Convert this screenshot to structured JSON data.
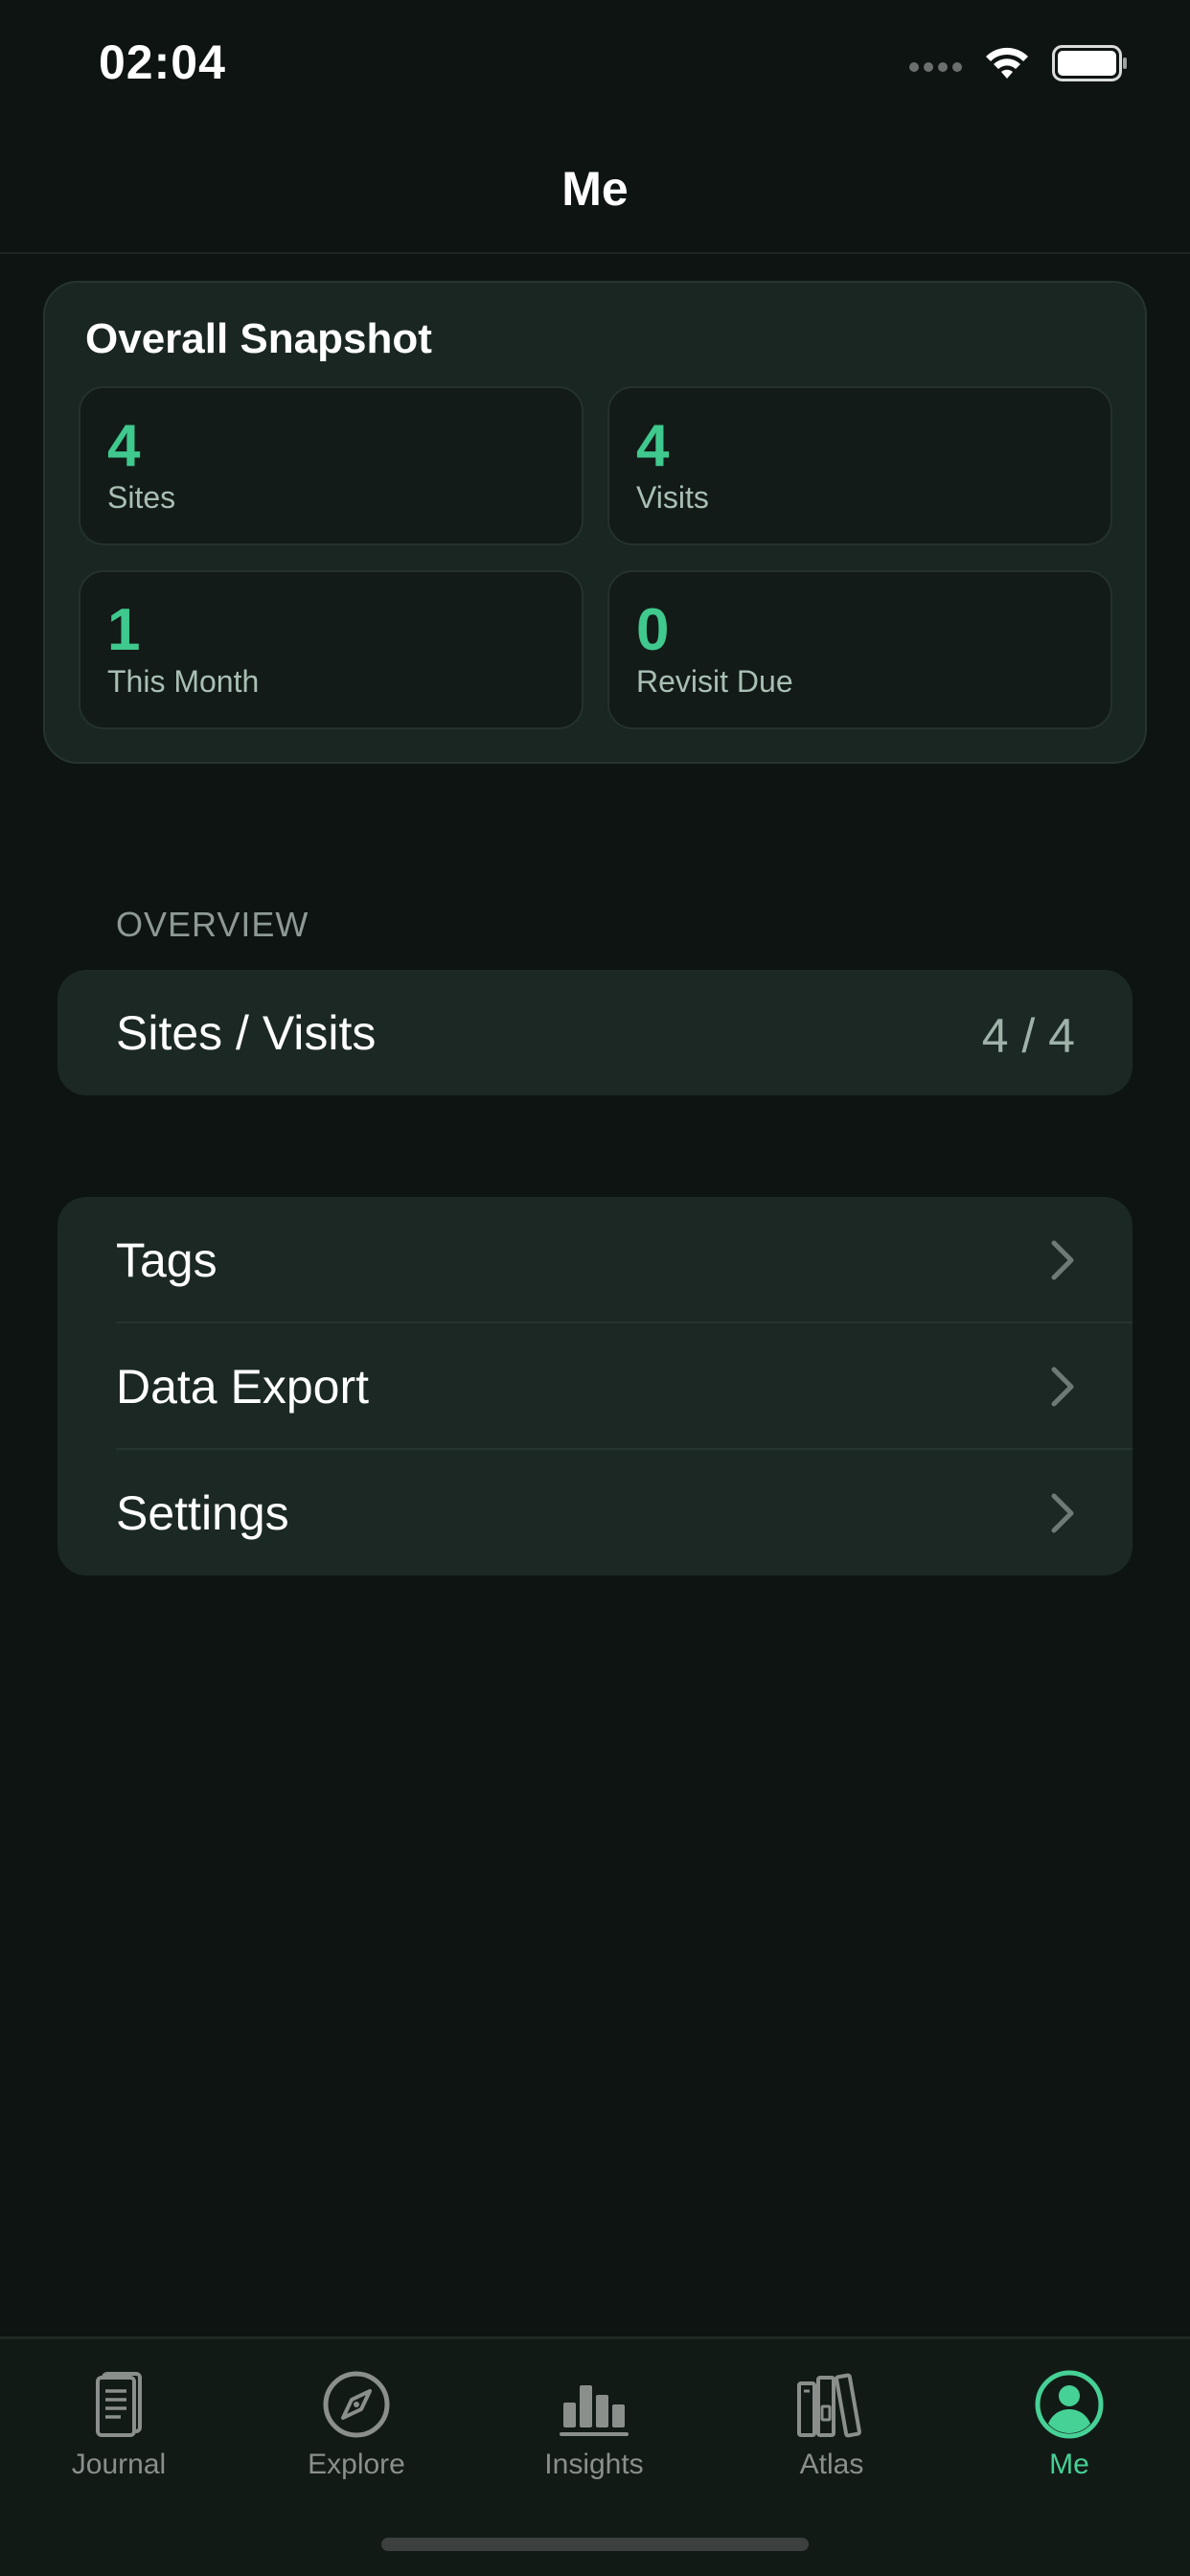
{
  "status_bar": {
    "time": "02:04"
  },
  "nav": {
    "title": "Me"
  },
  "snapshot": {
    "title": "Overall Snapshot",
    "stats": [
      {
        "value": "4",
        "label": "Sites"
      },
      {
        "value": "4",
        "label": "Visits"
      },
      {
        "value": "1",
        "label": "This Month"
      },
      {
        "value": "0",
        "label": "Revisit Due"
      }
    ]
  },
  "overview": {
    "header": "OVERVIEW",
    "row": {
      "label": "Sites / Visits",
      "value": "4 / 4"
    }
  },
  "menu": {
    "items": [
      {
        "label": "Tags",
        "icon": "chevron-right-icon"
      },
      {
        "label": "Data Export",
        "icon": "chevron-right-icon"
      },
      {
        "label": "Settings",
        "icon": "chevron-right-icon"
      }
    ]
  },
  "tab_bar": {
    "items": [
      {
        "label": "Journal",
        "icon": "journal-icon"
      },
      {
        "label": "Explore",
        "icon": "compass-icon"
      },
      {
        "label": "Insights",
        "icon": "bar-chart-icon"
      },
      {
        "label": "Atlas",
        "icon": "books-icon"
      },
      {
        "label": "Me",
        "icon": "person-circle-icon",
        "active": true
      }
    ]
  },
  "colors": {
    "accent": "#3fc98e",
    "background": "#0d1411",
    "card": "#1a2622"
  }
}
